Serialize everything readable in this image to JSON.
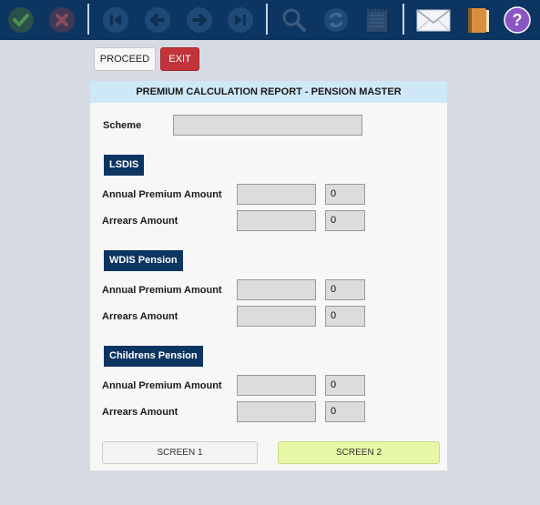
{
  "toolbar": {
    "icons": [
      "confirm-icon",
      "cancel-icon",
      "first-icon",
      "previous-icon",
      "next-icon",
      "last-icon",
      "search-icon",
      "refresh-icon",
      "notepad-icon",
      "mail-icon",
      "book-icon",
      "help-icon"
    ],
    "help_glyph": "?"
  },
  "actions": {
    "proceed_label": "PROCEED",
    "exit_label": "EXIT"
  },
  "panel": {
    "title": "PREMIUM CALCULATION REPORT - PENSION MASTER",
    "scheme_label": "Scheme",
    "scheme_value": "",
    "sections": [
      {
        "title": "LSDIS",
        "annual_label": "Annual Premium Amount",
        "annual_value": "0",
        "arrears_label": "Arrears Amount",
        "arrears_value": "0"
      },
      {
        "title": "WDIS Pension",
        "annual_label": "Annual Premium Amount",
        "annual_value": "0",
        "arrears_label": "Arrears Amount",
        "arrears_value": "0"
      },
      {
        "title": "Childrens Pension",
        "annual_label": "Annual Premium Amount",
        "annual_value": "0",
        "arrears_label": "Arrears Amount",
        "arrears_value": "0"
      }
    ],
    "screen1_label": "SCREEN 1",
    "screen2_label": "SCREEN 2"
  },
  "colors": {
    "toolbar_bg": "#0d3561",
    "exit_bg": "#c3343a",
    "header_bg": "#cfe8f7",
    "section_bg": "#0d3561",
    "screen2_bg": "#e6f7a6"
  }
}
